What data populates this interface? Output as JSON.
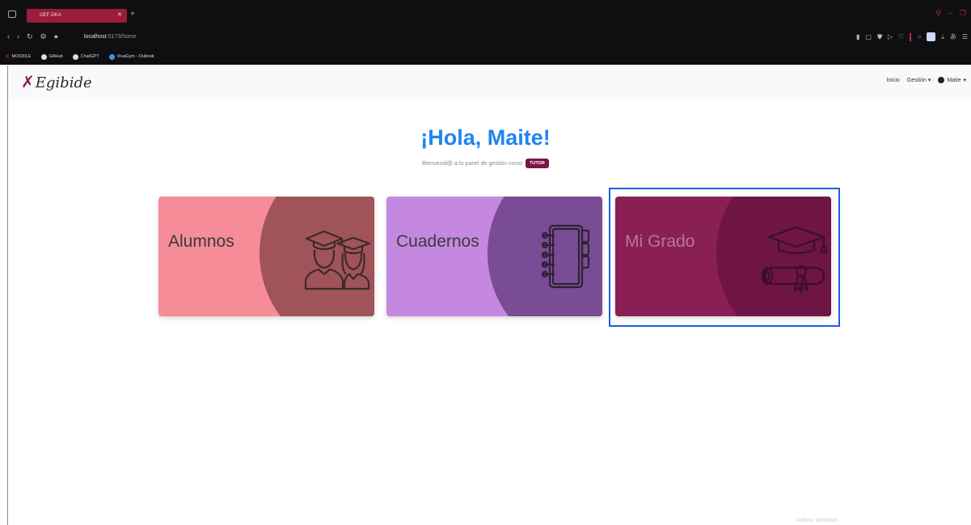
{
  "browser": {
    "tab_title": "OEF-DKA",
    "url_host": "localhost",
    "url_path": ":5173/home",
    "bookmarks": [
      {
        "label": "MOODLE",
        "icon": "moodle-icon"
      },
      {
        "label": "GitHub",
        "icon": "github-icon"
      },
      {
        "label": "ChatGPT",
        "icon": "chatgpt-icon"
      },
      {
        "label": "VivaGym - Outlook",
        "icon": "onedrive-icon"
      }
    ]
  },
  "navbar": {
    "logo": "Egibide",
    "inicio": "Inicio",
    "gestion": "Gestión",
    "user": "Maite"
  },
  "main": {
    "greeting": "¡Hola, Maite!",
    "subtitle": "Bienvenid@ a tu panel de gestión como",
    "role_badge": "TUTOR",
    "cards": [
      {
        "label": "Alumnos",
        "icon": "students-icon",
        "color": "#f58c98"
      },
      {
        "label": "Cuadernos",
        "icon": "notebook-icon",
        "color": "#c488e0"
      },
      {
        "label": "Mi Grado",
        "icon": "graduation-icon",
        "color": "#8a1f55"
      }
    ]
  },
  "watermark": "Activar Windows"
}
